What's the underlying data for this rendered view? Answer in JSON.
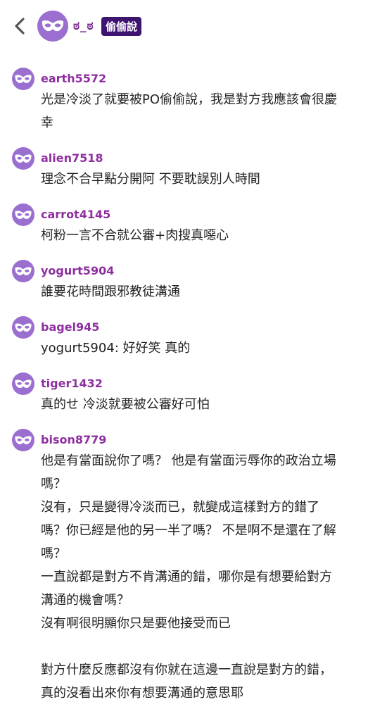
{
  "header": {
    "back_icon": "chevron-left-icon",
    "avatar_icon": "mask-icon",
    "name": "ಠ_ಠ",
    "badge": "偷偷說"
  },
  "comments": [
    {
      "username": "earth5572",
      "lines": [
        "光是冷淡了就要被PO偷偷說，我是對方我應該會很慶",
        "幸"
      ]
    },
    {
      "username": "alien7518",
      "lines": [
        "理念不合早點分開阿 不要耽誤別人時間"
      ]
    },
    {
      "username": "carrot4145",
      "lines": [
        "柯粉一言不合就公審+肉搜真噁心"
      ]
    },
    {
      "username": "yogurt5904",
      "lines": [
        "誰要花時間跟邪教徒溝通"
      ]
    },
    {
      "username": "bagel945",
      "lines": [
        "yogurt5904: 好好笑 真的"
      ]
    },
    {
      "username": "tiger1432",
      "lines": [
        "真的せ 冷淡就要被公審好可怕"
      ]
    },
    {
      "username": "bison8779",
      "lines": [
        "他是有當面說你了嗎？ 他是有當面污辱你的政治立場",
        "嗎？",
        "沒有，只是變得冷淡而已，就變成這樣對方的錯了",
        "嗎？你已經是他的另一半了嗎？ 不是啊不是還在了解",
        "嗎？",
        "一直說都是對方不肯溝通的錯，哪你是有想要給對方",
        "溝通的機會嗎？",
        "沒有啊很明顯你只是要他接受而已",
        "",
        "對方什麼反應都沒有你就在這邊一直說是對方的錯，",
        "真的沒看出來你有想要溝通的意思耶"
      ]
    }
  ]
}
